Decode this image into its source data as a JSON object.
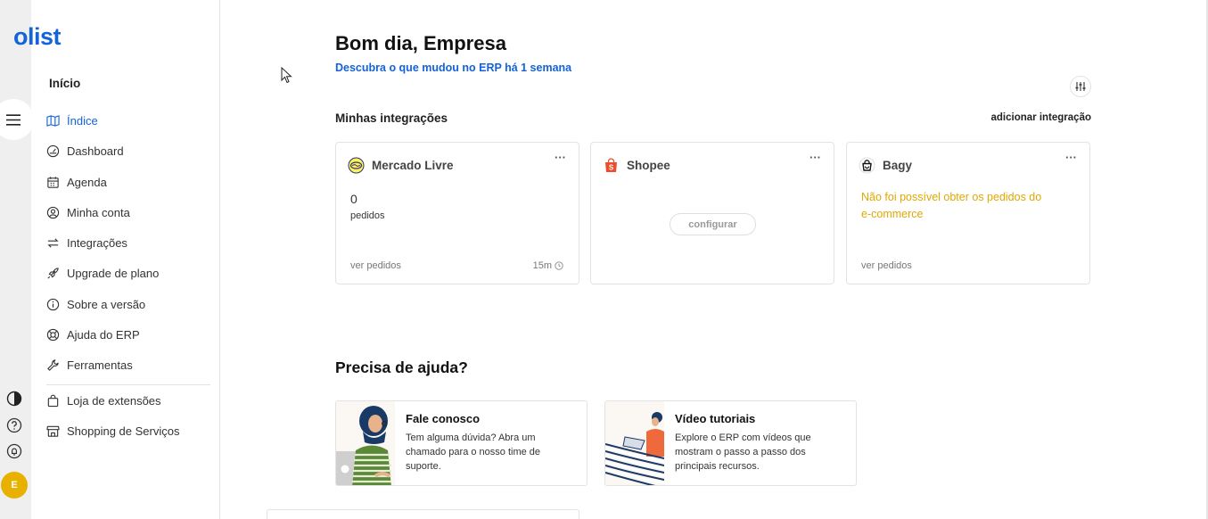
{
  "app": {
    "logo": "olist",
    "avatar_initial": "E"
  },
  "sidebar": {
    "title": "Início",
    "items": [
      {
        "label": "Índice",
        "icon": "map-icon",
        "active": true
      },
      {
        "label": "Dashboard",
        "icon": "gauge-icon"
      },
      {
        "label": "Agenda",
        "icon": "calendar-icon"
      },
      {
        "label": "Minha conta",
        "icon": "user-circle-icon"
      },
      {
        "label": "Integrações",
        "icon": "arrows-exchange-icon"
      },
      {
        "label": "Upgrade de plano",
        "icon": "rocket-icon"
      },
      {
        "label": "Sobre a versão",
        "icon": "info-icon"
      },
      {
        "label": "Ajuda do ERP",
        "icon": "lifebuoy-icon"
      },
      {
        "label": "Ferramentas",
        "icon": "wrench-icon"
      },
      {
        "label": "Loja de extensões",
        "icon": "shopping-bag-icon"
      },
      {
        "label": "Shopping de Serviços",
        "icon": "storefront-icon"
      }
    ]
  },
  "main": {
    "greeting": "Bom dia, Empresa",
    "erp_link": "Descubra o que mudou no ERP há 1 semana",
    "integrations": {
      "title": "Minhas integrações",
      "add_label": "adicionar integração",
      "cards": [
        {
          "name": "Mercado Livre",
          "count": "0",
          "count_label": "pedidos",
          "link": "ver pedidos",
          "time": "15m",
          "menu": "···"
        },
        {
          "name": "Shopee",
          "configure": "configurar",
          "menu": "···"
        },
        {
          "name": "Bagy",
          "warning": "Não foi possível obter os pedidos do e-commerce",
          "link": "ver pedidos",
          "menu": "···"
        }
      ]
    },
    "help": {
      "title": "Precisa de ajuda?",
      "cards": [
        {
          "title": "Fale conosco",
          "text": "Tem alguma dúvida? Abra um chamado para o nosso time de suporte."
        },
        {
          "title": "Vídeo tutoriais",
          "text": "Explore o ERP com vídeos que mostram o passo a passo dos principais recursos."
        }
      ]
    }
  },
  "colors": {
    "brand": "#1463d8",
    "warning": "#e0a800",
    "avatar": "#e8b100"
  }
}
